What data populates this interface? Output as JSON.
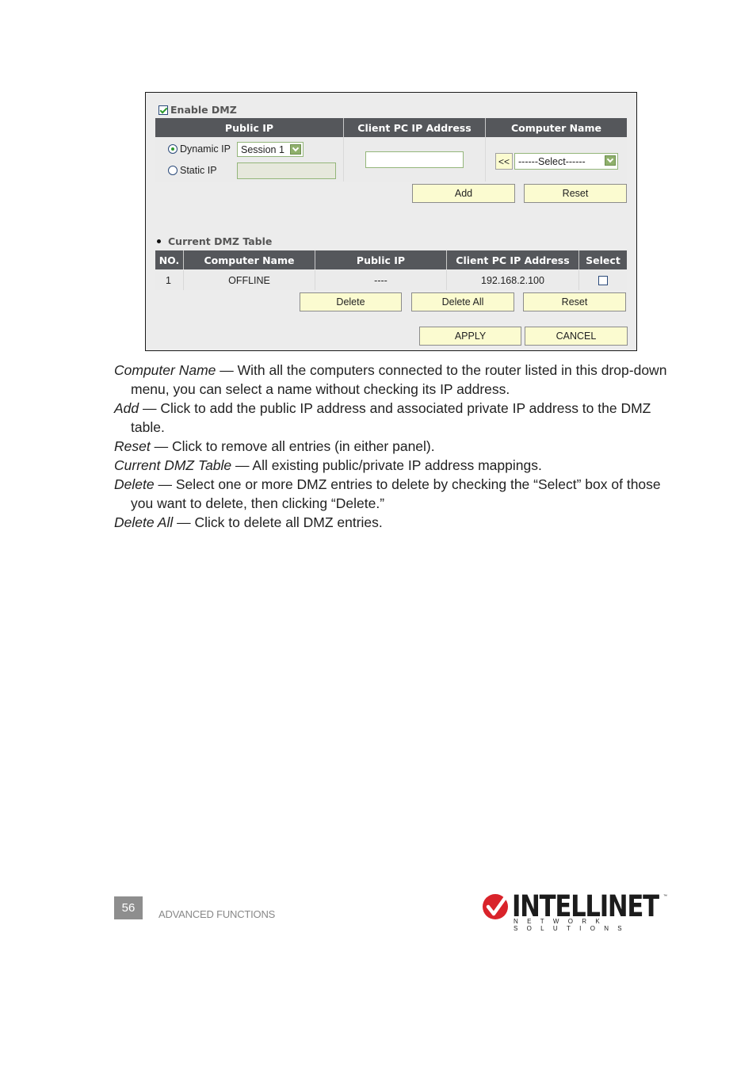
{
  "dmz_form": {
    "enable_label": "Enable DMZ",
    "enable_checked": true,
    "headers": [
      "Public IP",
      "Client PC IP Address",
      "Computer Name"
    ],
    "dynamic_ip_label": "Dynamic IP",
    "dynamic_ip_selected": true,
    "session_select_value": "Session 1",
    "static_ip_label": "Static IP",
    "static_ip_value": "",
    "client_ip_value": "",
    "copy_button_label": "<<",
    "computer_select_value": "------Select------",
    "add_label": "Add",
    "reset_label": "Reset"
  },
  "dmz_table": {
    "title": "Current DMZ Table",
    "columns": [
      "NO.",
      "Computer Name",
      "Public IP",
      "Client PC IP Address",
      "Select"
    ],
    "rows": [
      {
        "no": "1",
        "computer_name": "OFFLINE",
        "public_ip": "----",
        "client_ip": "192.168.2.100",
        "selected": false
      }
    ],
    "delete_label": "Delete",
    "delete_all_label": "Delete All",
    "reset_label": "Reset",
    "apply_label": "APPLY",
    "cancel_label": "CANCEL"
  },
  "descriptions": [
    {
      "term": "Computer Name",
      "text": " — With all the computers connected to the router listed in this drop-down menu, you can select a name without checking its IP address."
    },
    {
      "term": "Add",
      "text": " — Click to add the public IP address and associated private IP address to the DMZ table."
    },
    {
      "term": "Reset",
      "text": " — Click to remove all entries (in either panel)."
    },
    {
      "term": "Current DMZ Table",
      "text": " — All existing public/private IP address mappings."
    },
    {
      "term": "Delete",
      "text": " — Select one or more DMZ entries to delete by checking the “Select” box of those you want to delete, then clicking “Delete.”"
    },
    {
      "term": "Delete All",
      "text": " — Click to delete all DMZ entries."
    }
  ],
  "footer": {
    "page_number": "56",
    "section": "ADVANCED FUNCTIONS",
    "logo_word": "INTELLINET",
    "logo_sub": "NETWORK SOLUTIONS",
    "logo_tm": "™",
    "logo_color": "#d9232a"
  }
}
